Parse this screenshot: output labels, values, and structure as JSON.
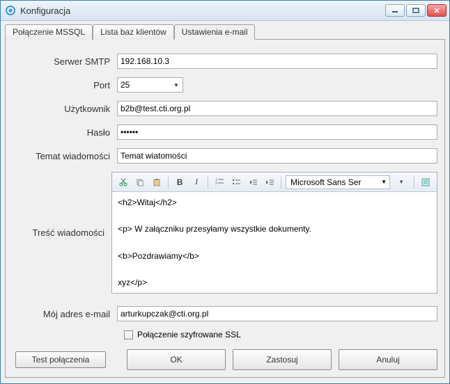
{
  "window": {
    "title": "Konfiguracja"
  },
  "tabs": {
    "mssql": "Połączenie MSSQL",
    "clients": "Lista baz klientów",
    "email": "Ustawienia e-mail"
  },
  "labels": {
    "smtp": "Serwer SMTP",
    "port": "Port",
    "user": "Użytkownik",
    "pass": "Hasło",
    "subject": "Temat wiadomości",
    "body": "Treść wiadomości",
    "myemail": "Mój adres e-mail",
    "ssl": "Połączenie szyfrowane SSL"
  },
  "values": {
    "smtp": "192.168.10.3",
    "port": "25",
    "user": "b2b@test.cti.org.pl",
    "pass": "••••••",
    "subject": "Temat wiatomości",
    "body": "<h2>Witaj</h2>\n\n<p> W załączniku przesyłamy wszystkie dokumenty.\n\n<b>Pozdrawiamy</b>\n\nxyz</p>",
    "myemail": "arturkupczak@cti.org.pl",
    "ssl_checked": false
  },
  "editor_toolbar": {
    "font": "Microsoft Sans Ser"
  },
  "buttons": {
    "test": "Test połączenia",
    "ok": "OK",
    "apply": "Zastosuj",
    "cancel": "Anuluj"
  },
  "colors": {
    "accent": "#d7e4f2"
  }
}
